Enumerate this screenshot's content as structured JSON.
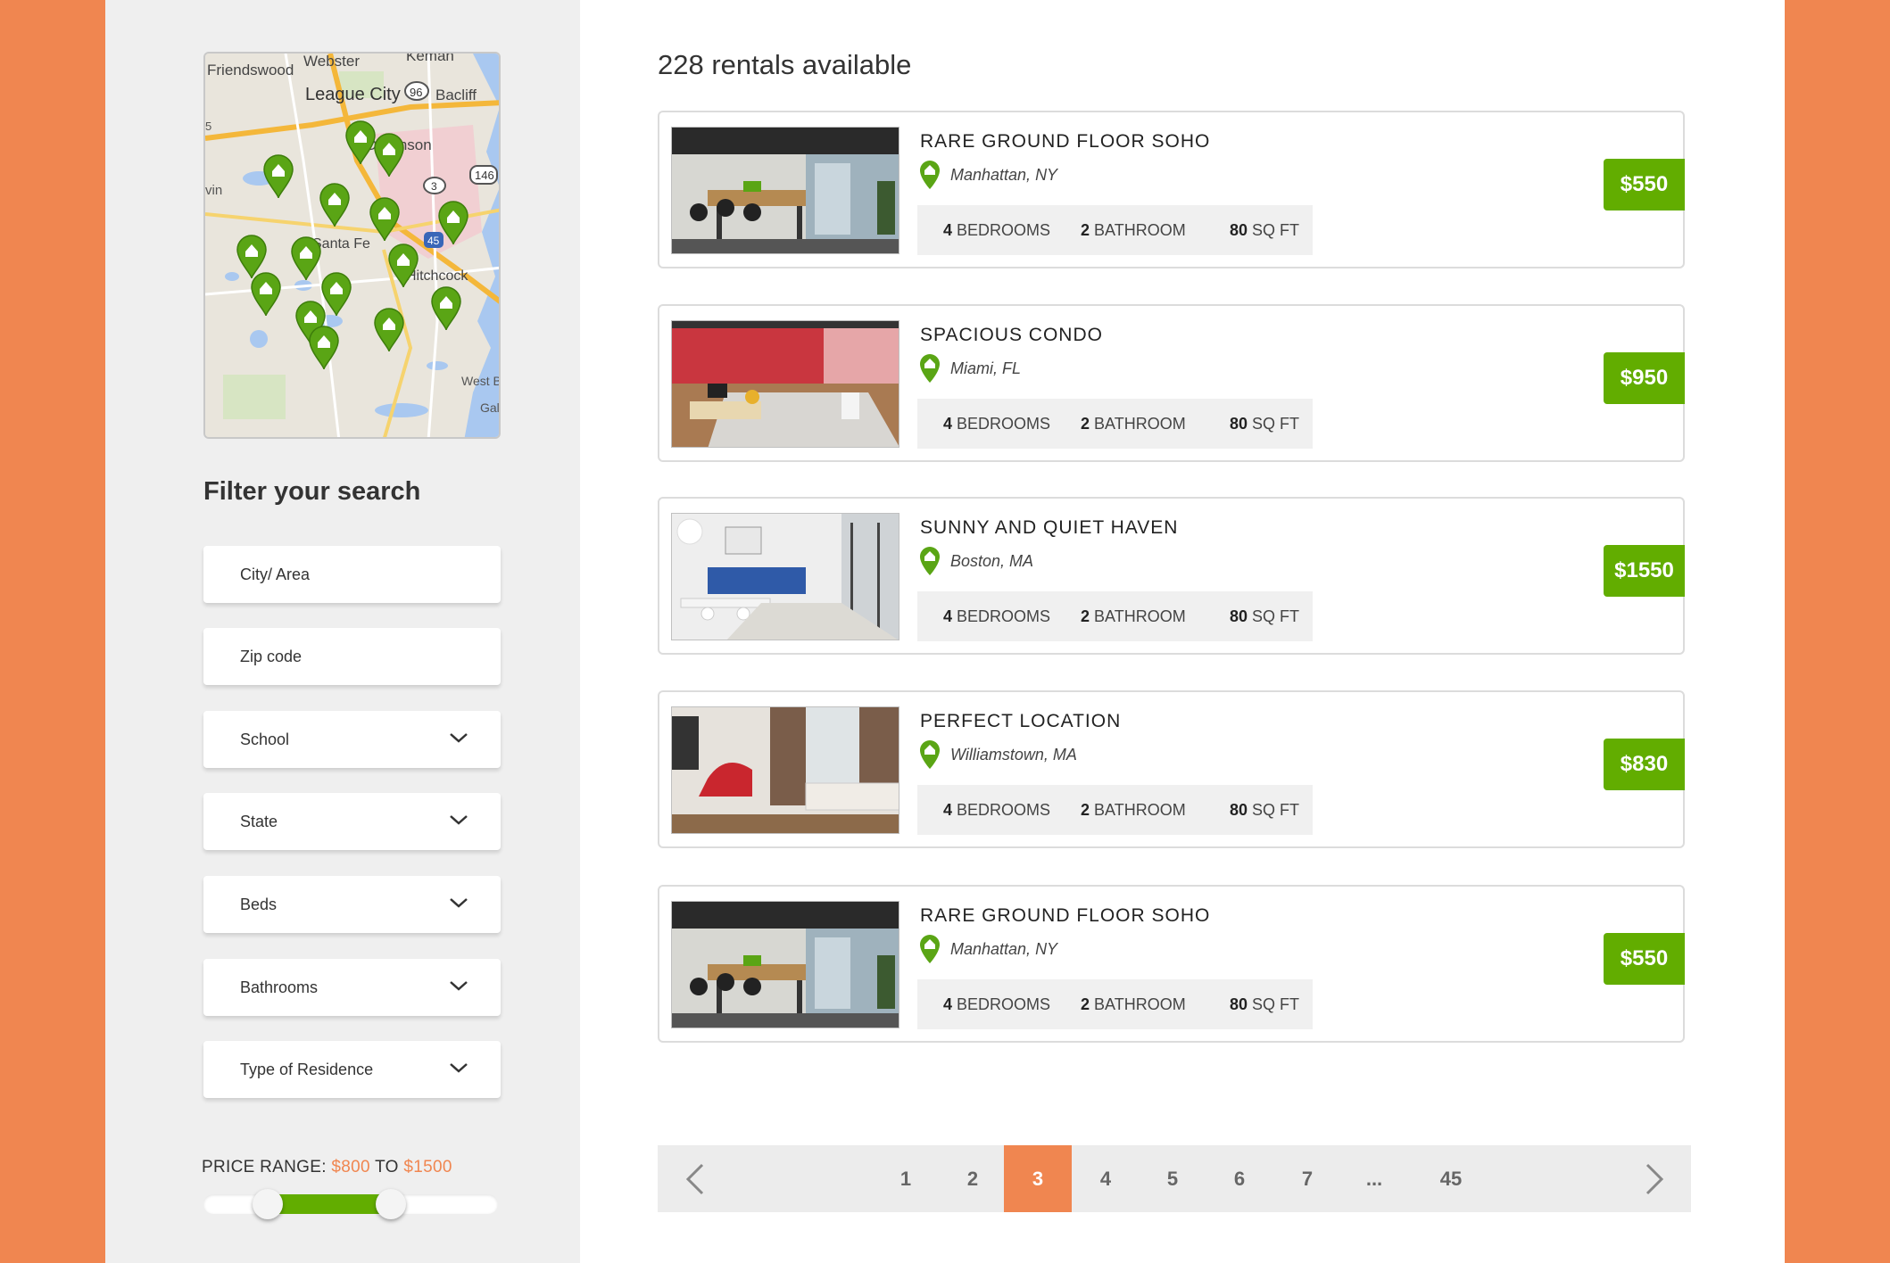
{
  "colors": {
    "accent": "#f08650",
    "green": "#62ad00"
  },
  "sidebar": {
    "filter_title": "Filter your search",
    "fields": [
      {
        "label": "City/ Area",
        "dropdown": false
      },
      {
        "label": "Zip code",
        "dropdown": false
      },
      {
        "label": "School",
        "dropdown": true
      },
      {
        "label": "State",
        "dropdown": true
      },
      {
        "label": "Beds",
        "dropdown": true
      },
      {
        "label": "Bathrooms",
        "dropdown": true
      },
      {
        "label": "Type of Residence",
        "dropdown": true
      }
    ],
    "price": {
      "prefix": "PRICE RANGE:",
      "min": "$800",
      "to": "TO",
      "max": "$1500"
    }
  },
  "map": {
    "labels": [
      "Webster",
      "Kemah",
      "Friendswood",
      "League City",
      "Bacliff",
      "Dickinson",
      "Santa Fe",
      "Hitchcock",
      "West B",
      "Gal",
      "vin",
      "5"
    ],
    "shields": [
      "96",
      "3",
      "146",
      "45"
    ]
  },
  "main": {
    "count_label": "228 rentals available",
    "listings": [
      {
        "title": "RARE GROUND FLOOR SOHO",
        "location": "Manhattan, NY",
        "beds_num": "4",
        "beds_unit": "BEDROOMS",
        "baths_num": "2",
        "baths_unit": "BATHROOM",
        "area_num": "80",
        "area_unit": "SQ FT",
        "price": "$550"
      },
      {
        "title": "SPACIOUS CONDO",
        "location": "Miami, FL",
        "beds_num": "4",
        "beds_unit": "BEDROOMS",
        "baths_num": "2",
        "baths_unit": "BATHROOM",
        "area_num": "80",
        "area_unit": "SQ FT",
        "price": "$950"
      },
      {
        "title": "SUNNY AND QUIET HAVEN",
        "location": "Boston, MA",
        "beds_num": "4",
        "beds_unit": "BEDROOMS",
        "baths_num": "2",
        "baths_unit": "BATHROOM",
        "area_num": "80",
        "area_unit": "SQ FT",
        "price": "$1550"
      },
      {
        "title": "PERFECT LOCATION",
        "location": "Williamstown, MA",
        "beds_num": "4",
        "beds_unit": "BEDROOMS",
        "baths_num": "2",
        "baths_unit": "BATHROOM",
        "area_num": "80",
        "area_unit": "SQ FT",
        "price": "$830"
      },
      {
        "title": "RARE GROUND FLOOR SOHO",
        "location": "Manhattan, NY",
        "beds_num": "4",
        "beds_unit": "BEDROOMS",
        "baths_num": "2",
        "baths_unit": "BATHROOM",
        "area_num": "80",
        "area_unit": "SQ FT",
        "price": "$550"
      }
    ]
  },
  "pagination": {
    "pages": [
      "1",
      "2",
      "3",
      "4",
      "5",
      "6",
      "7",
      "...",
      "45"
    ],
    "active": "3",
    "prev_icon": "chevron-left-icon",
    "next_icon": "chevron-right-icon"
  }
}
